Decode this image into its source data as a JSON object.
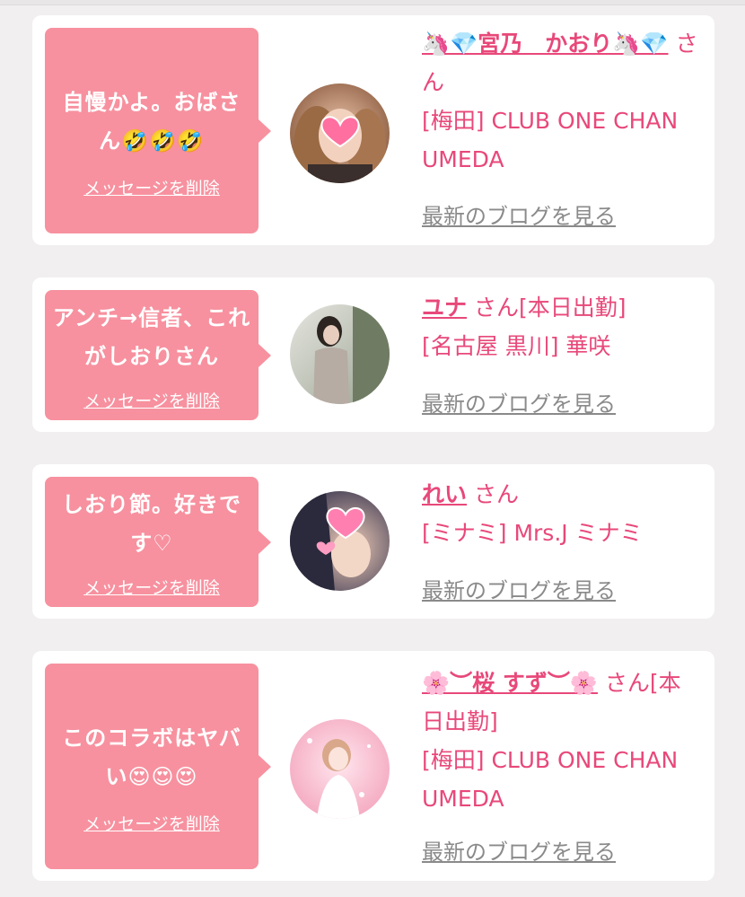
{
  "cards": [
    {
      "message": "自慢かよ。おばさん🤣🤣🤣",
      "delete_label": "メッセージを削除",
      "name": "🦄💎宮乃　かおり🦄💎",
      "san": "さん",
      "shop": "[梅田] CLUB ONE CHAN UMEDA",
      "blog_label": "最新のブログを見る"
    },
    {
      "message": "アンチ→信者、これがしおりさん",
      "delete_label": "メッセージを削除",
      "name": "ユナ",
      "san": "さん[本日出勤]",
      "shop": "[名古屋 黒川] 華咲",
      "blog_label": "最新のブログを見る"
    },
    {
      "message": "しおり節。好きです♡",
      "delete_label": "メッセージを削除",
      "name": "れい",
      "san": "さん",
      "shop": "[ミナミ] Mrs.J ミナミ",
      "blog_label": "最新のブログを見る"
    },
    {
      "message": "このコラボはヤバい😍😍😍",
      "delete_label": "メッセージを削除",
      "name": "🌸︶桜 すず︶🌸",
      "san": "さん[本日出勤]",
      "shop": "[梅田] CLUB ONE CHAN UMEDA",
      "blog_label": "最新のブログを見る"
    }
  ],
  "colors": {
    "background": "#f1eff0",
    "bubble": "#f7919f",
    "accent": "#e8487a",
    "link_gray": "#8a8a8a"
  }
}
